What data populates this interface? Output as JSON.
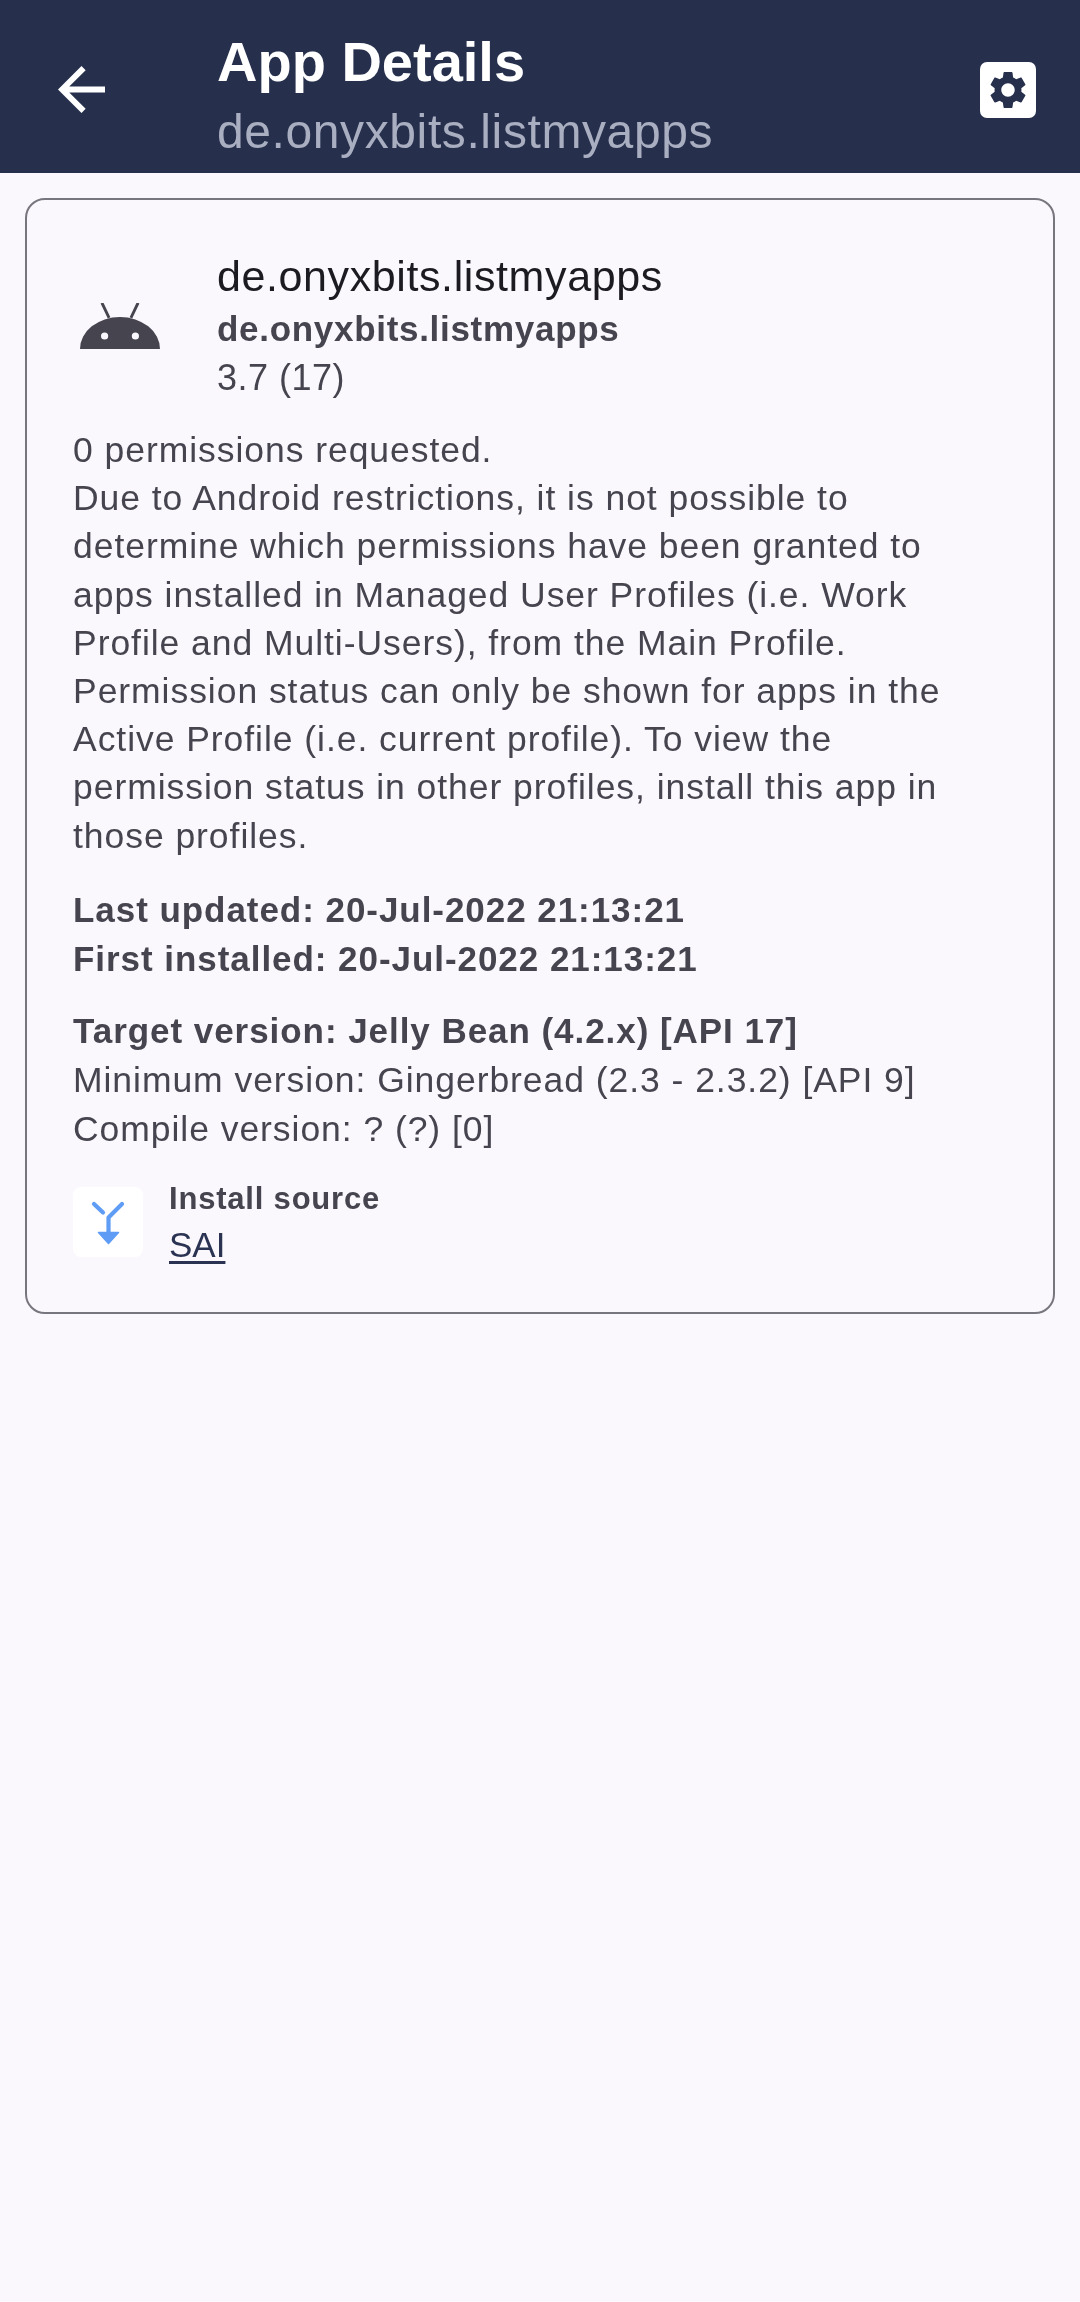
{
  "app_bar": {
    "title": "App Details",
    "subtitle": "de.onyxbits.listmyapps"
  },
  "app_card": {
    "name": "de.onyxbits.listmyapps",
    "package": "de.onyxbits.listmyapps",
    "version": "3.7 (17)",
    "permissions": [
      "0 permissions requested.",
      "Due to Android restrictions, it is not possible to determine which permissions have been granted to apps installed in Managed User Profiles (i.e. Work Profile and Multi-Users), from the Main Profile. Permission status can only be shown for apps in the Active Profile (i.e. current profile). To view the permission status in other profiles, install this app in those profiles."
    ],
    "dates": [
      "Last updated: 20-Jul-2022 21:13:21",
      "First installed: 20-Jul-2022 21:13:21"
    ],
    "sdk_versions": [
      {
        "text": "Target version: Jelly Bean (4.2.x) [API 17]",
        "emphasized": true
      },
      {
        "text": "Minimum version: Gingerbread (2.3 - 2.3.2) [API 9]",
        "emphasized": false
      },
      {
        "text": "Compile version: ? (?) [0]",
        "emphasized": false
      }
    ],
    "install_source": {
      "label": "Install source",
      "value": "SAI"
    }
  }
}
